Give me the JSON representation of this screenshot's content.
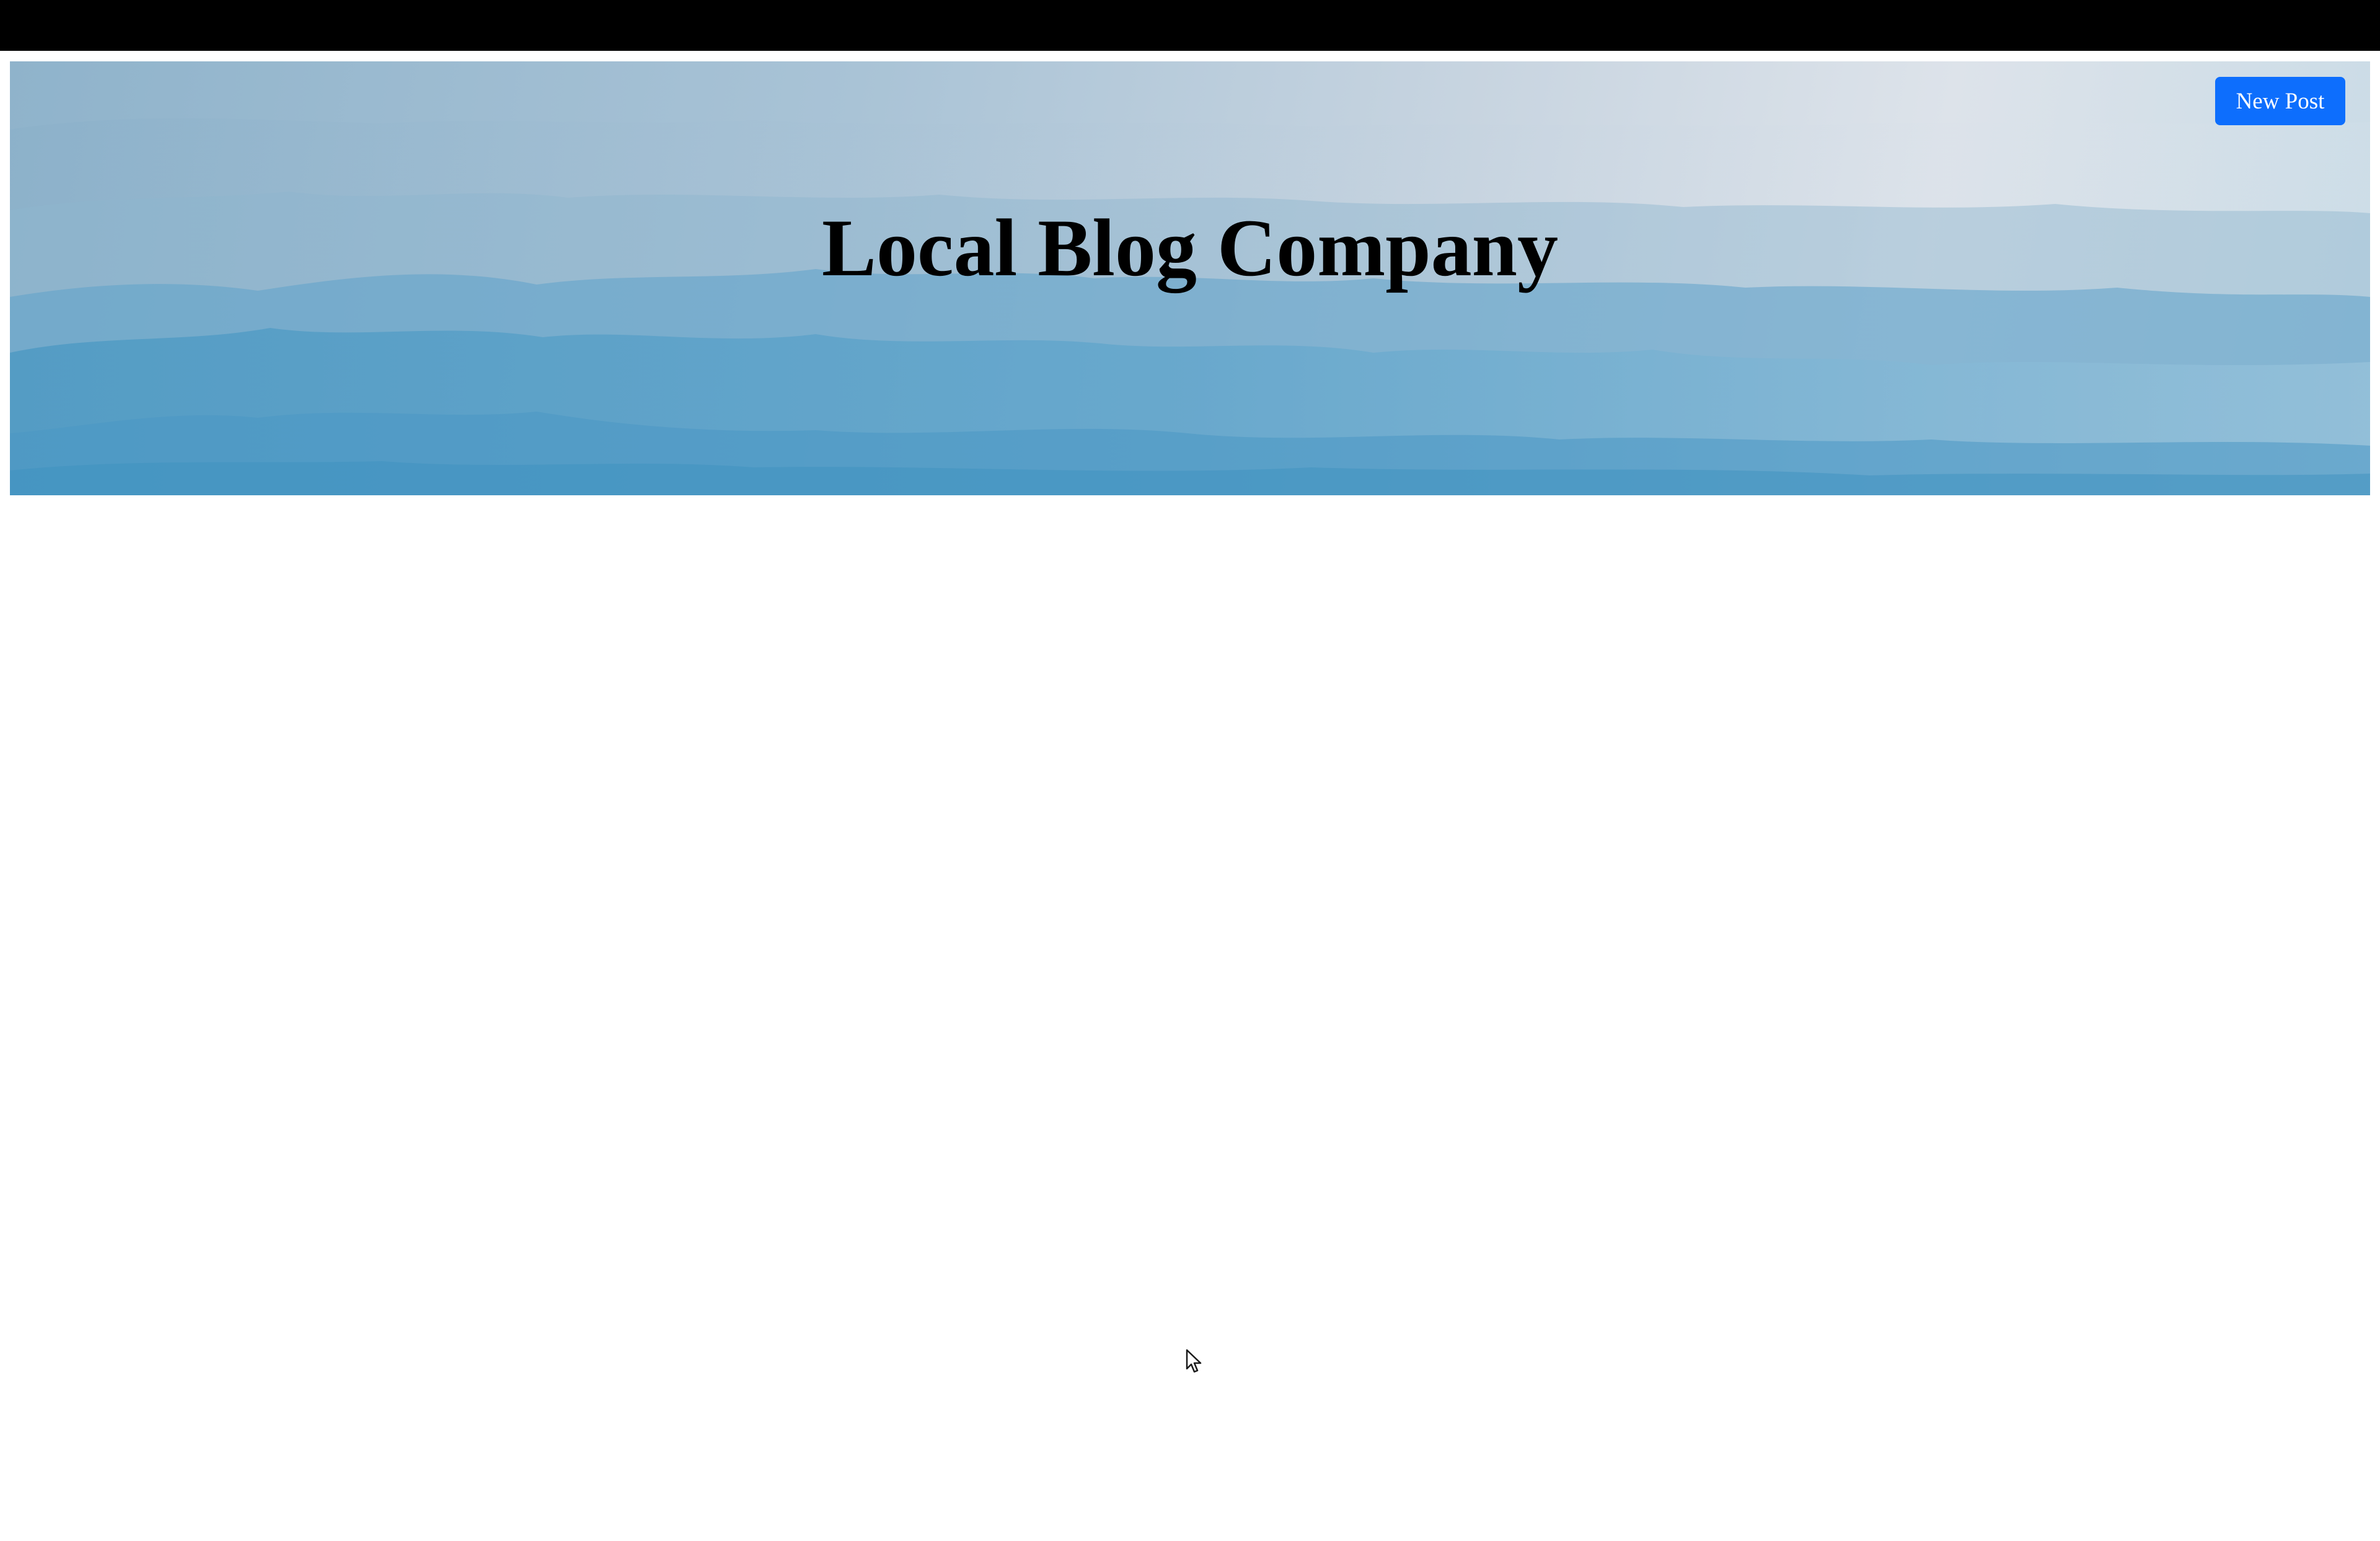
{
  "header": {
    "title": "Local Blog Company",
    "new_post_label": "New Post"
  },
  "colors": {
    "top_bar": "#000000",
    "button_bg": "#0d6efd",
    "button_text": "#ffffff",
    "title_text": "#000000",
    "hero_tint": "#8fb3cb"
  },
  "icons": {
    "cursor": "mouse-pointer-icon"
  }
}
